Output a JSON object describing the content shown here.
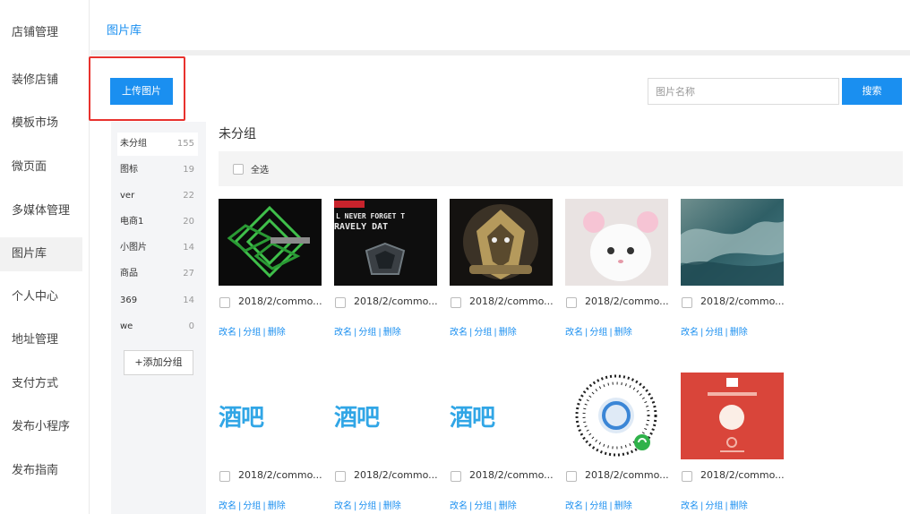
{
  "sidebar": {
    "items": [
      {
        "label": "店铺管理"
      },
      {
        "label": "装修店铺"
      },
      {
        "label": "模板市场"
      },
      {
        "label": "微页面"
      },
      {
        "label": "多媒体管理"
      },
      {
        "label": "图片库"
      },
      {
        "label": "个人中心"
      },
      {
        "label": "地址管理"
      },
      {
        "label": "支付方式"
      },
      {
        "label": "发布小程序"
      },
      {
        "label": "发布指南"
      }
    ],
    "active": "图片库"
  },
  "tabs": [
    {
      "label": "图片库"
    }
  ],
  "toolbar": {
    "upload_label": "上传图片",
    "search_placeholder": "图片名称",
    "search_label": "搜索"
  },
  "groups": {
    "items": [
      {
        "name": "未分组",
        "count": "155"
      },
      {
        "name": "图标",
        "count": "19"
      },
      {
        "name": "ver",
        "count": "22"
      },
      {
        "name": "电商1",
        "count": "20"
      },
      {
        "name": "小图片",
        "count": "14"
      },
      {
        "name": "商品",
        "count": "27"
      },
      {
        "name": "369",
        "count": "14"
      },
      {
        "name": "we",
        "count": "0"
      }
    ],
    "add_label": "+添加分组"
  },
  "gallery": {
    "title": "未分组",
    "select_all_label": "全选",
    "actions": {
      "rename": "改名",
      "group": "分组",
      "delete": "删除",
      "separator": "|"
    },
    "images": [
      {
        "name": "2018/2/commo...",
        "thumb": "green-diamond-logo"
      },
      {
        "name": "2018/2/commo...",
        "thumb": "never-forget-poster",
        "text1": "L NEVER FORGET T",
        "text2": "RAVELY DAT"
      },
      {
        "name": "2018/2/commo...",
        "thumb": "lion-emblem"
      },
      {
        "name": "2018/2/commo...",
        "thumb": "white-cat-photo"
      },
      {
        "name": "2018/2/commo...",
        "thumb": "ocean-waves-photo"
      },
      {
        "name": "2018/2/commo...",
        "thumb": "calligraphy-text",
        "text": "酒吧"
      },
      {
        "name": "2018/2/commo...",
        "thumb": "calligraphy-text",
        "text": "酒吧"
      },
      {
        "name": "2018/2/commo...",
        "thumb": "calligraphy-text",
        "text": "酒吧"
      },
      {
        "name": "2018/2/commo...",
        "thumb": "miniprogram-code"
      },
      {
        "name": "2018/2/commo...",
        "thumb": "red-envelope"
      }
    ]
  },
  "colors": {
    "accent": "#1a8ff0",
    "highlight": "#e8322e"
  }
}
